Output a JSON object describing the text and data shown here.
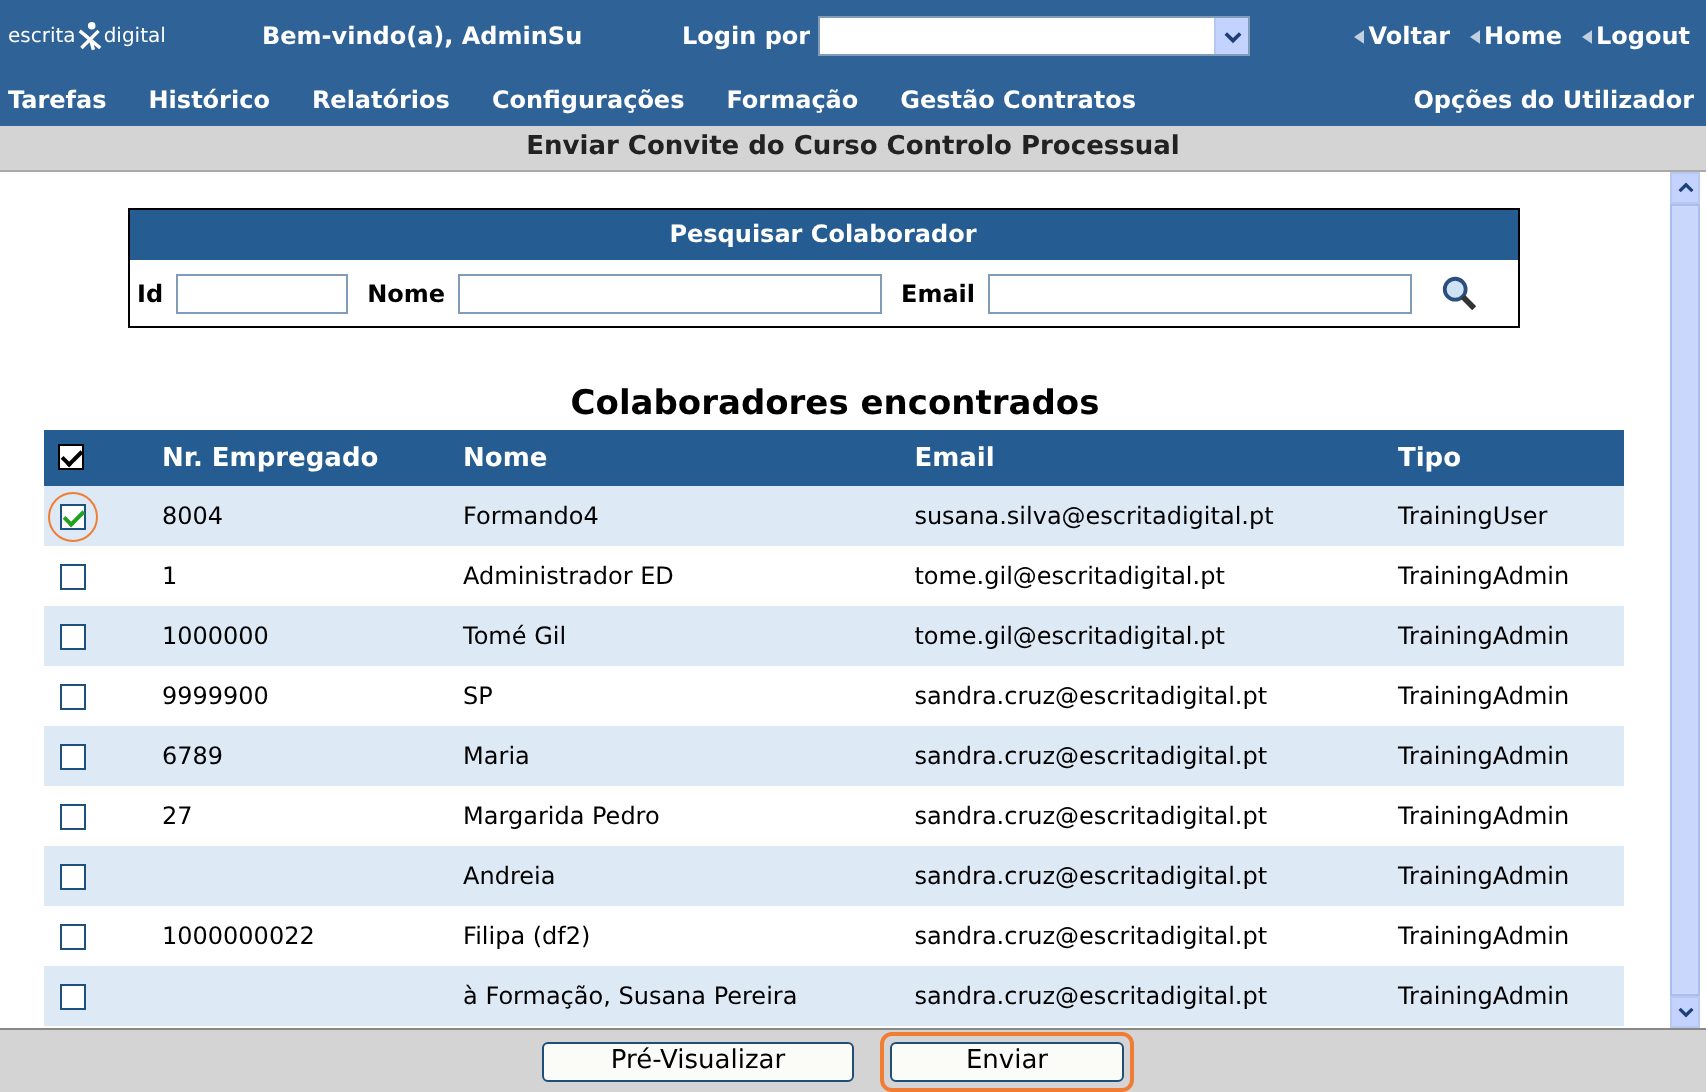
{
  "header": {
    "logo": {
      "left": "escrita",
      "right": "digital"
    },
    "welcome": "Bem-vindo(a), AdminSu",
    "login_label": "Login por",
    "links": [
      "Voltar",
      "Home",
      "Logout"
    ]
  },
  "menu": {
    "items": [
      "Tarefas",
      "Histórico",
      "Relatórios",
      "Configurações",
      "Formação",
      "Gestão Contratos"
    ],
    "user_options": "Opções do Utilizador"
  },
  "page_title": "Enviar Convite do Curso Controlo Processual",
  "search": {
    "title": "Pesquisar Colaborador",
    "fields": [
      {
        "label": "Id"
      },
      {
        "label": "Nome"
      },
      {
        "label": "Email"
      }
    ]
  },
  "results": {
    "title": "Colaboradores encontrados",
    "select_all_checked": true,
    "columns": [
      "Nr. Empregado",
      "Nome",
      "Email",
      "Tipo"
    ],
    "rows": [
      {
        "checked": true,
        "highlighted": true,
        "cells": [
          "8004",
          "Formando4",
          "susana.silva@escritadigital.pt",
          "TrainingUser"
        ]
      },
      {
        "checked": false,
        "highlighted": false,
        "cells": [
          "1",
          "Administrador ED",
          "tome.gil@escritadigital.pt",
          "TrainingAdmin"
        ]
      },
      {
        "checked": false,
        "highlighted": false,
        "cells": [
          "1000000",
          "Tomé Gil",
          "tome.gil@escritadigital.pt",
          "TrainingAdmin"
        ]
      },
      {
        "checked": false,
        "highlighted": false,
        "cells": [
          "9999900",
          "SP",
          "sandra.cruz@escritadigital.pt",
          "TrainingAdmin"
        ]
      },
      {
        "checked": false,
        "highlighted": false,
        "cells": [
          "6789",
          "Maria",
          "sandra.cruz@escritadigital.pt",
          "TrainingAdmin"
        ]
      },
      {
        "checked": false,
        "highlighted": false,
        "cells": [
          "27",
          "Margarida Pedro",
          "sandra.cruz@escritadigital.pt",
          "TrainingAdmin"
        ]
      },
      {
        "checked": false,
        "highlighted": false,
        "cells": [
          "",
          "Andreia",
          "sandra.cruz@escritadigital.pt",
          "TrainingAdmin"
        ]
      },
      {
        "checked": false,
        "highlighted": false,
        "cells": [
          "1000000022",
          "Filipa (df2)",
          "sandra.cruz@escritadigital.pt",
          "TrainingAdmin"
        ]
      },
      {
        "checked": false,
        "highlighted": false,
        "cells": [
          "",
          "à Formação, Susana Pereira",
          "sandra.cruz@escritadigital.pt",
          "TrainingAdmin"
        ]
      }
    ]
  },
  "buttons": [
    {
      "label": "Pré-Visualizar",
      "highlighted": false
    },
    {
      "label": "Enviar",
      "highlighted": true
    }
  ]
}
